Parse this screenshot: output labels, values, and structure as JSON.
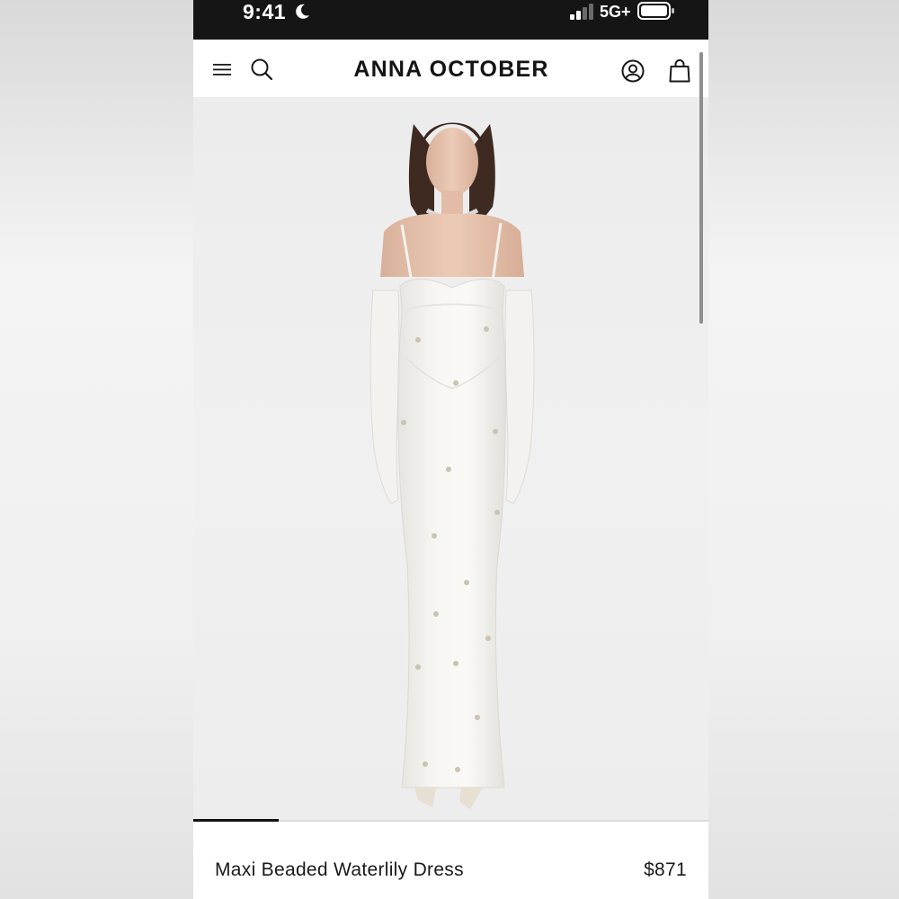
{
  "status_bar": {
    "time": "9:41",
    "network": "5G+",
    "icons": [
      "moon-icon",
      "signal-icon",
      "battery-icon"
    ]
  },
  "header": {
    "brand": "ANNA OCTOBER",
    "icons": [
      "menu-icon",
      "search-icon",
      "account-icon",
      "bag-icon"
    ]
  },
  "gallery": {
    "active_index": 1
  },
  "product": {
    "name": "Maxi Beaded Waterlily Dress",
    "price": "$871"
  },
  "colors": {
    "status_bar_bg": "#151515",
    "text": "#1a1a1a",
    "image_bg": "#ededed",
    "dress": "#f4f2ee"
  }
}
